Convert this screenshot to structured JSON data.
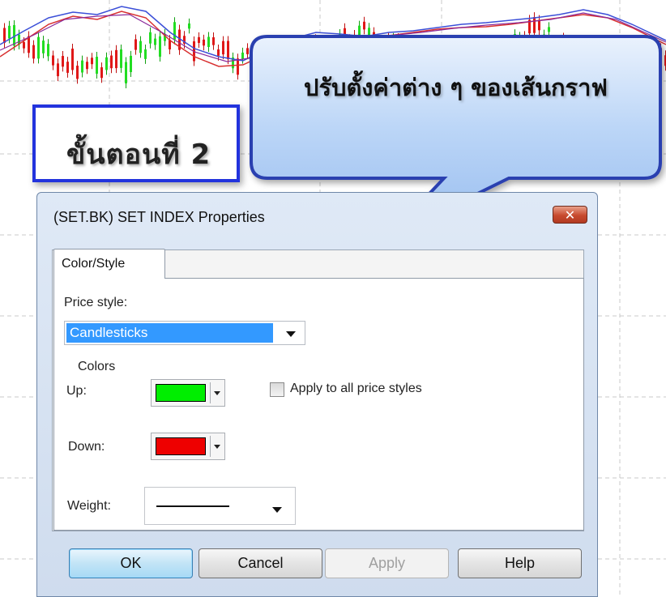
{
  "step_label": "ขั้นตอนที่ 2",
  "callout_text": "ปรับตั้งค่าต่าง ๆ ของเส้นกราฟ",
  "dialog": {
    "title": "(SET.BK) SET INDEX Properties",
    "close_label": "✕",
    "tab_label": "Color/Style",
    "price_style_label": "Price style:",
    "price_style_value": "Candlesticks",
    "colors_label": "Colors",
    "up_label": "Up:",
    "up_color": "#00ee00",
    "down_label": "Down:",
    "down_color": "#ee0000",
    "apply_all_label": "Apply to all price styles",
    "weight_label": "Weight:",
    "buttons": {
      "ok": "OK",
      "cancel": "Cancel",
      "apply": "Apply",
      "help": "Help"
    }
  },
  "colors": {
    "step_border": "#2233dd",
    "callout_fill": "#a8c8f4",
    "callout_border": "#2a3fb0",
    "selection": "#3399ff"
  }
}
